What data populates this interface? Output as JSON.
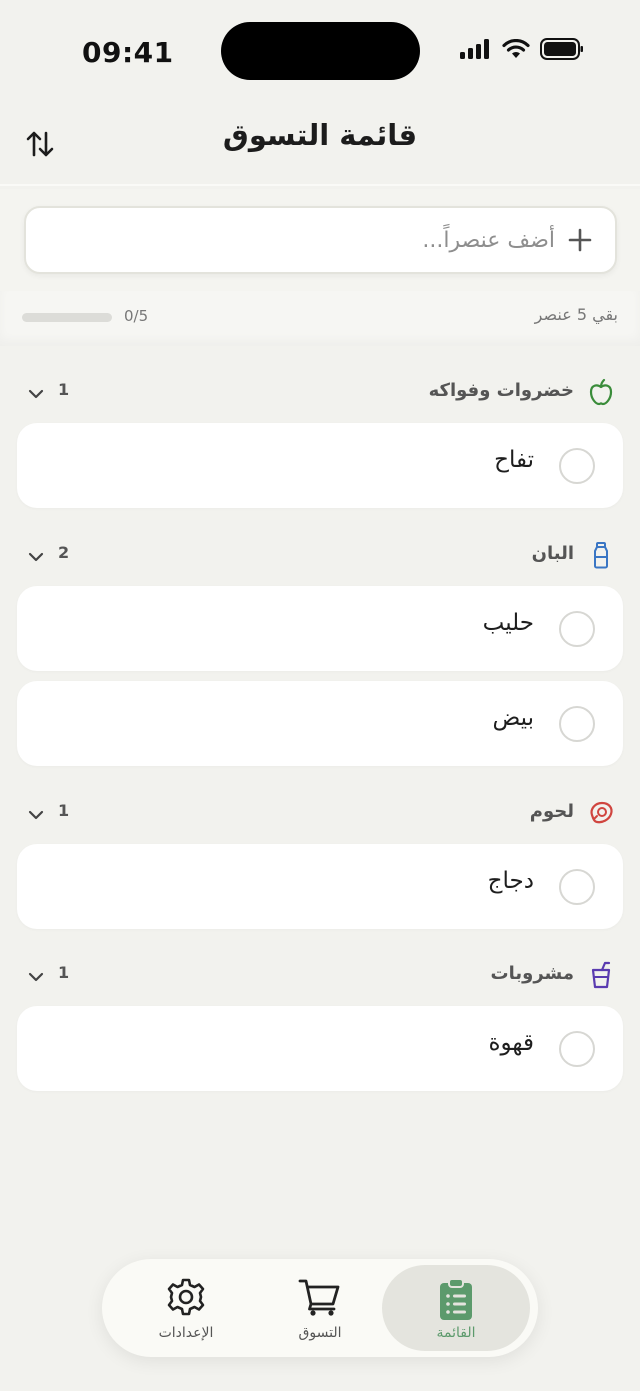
{
  "status_bar": {
    "time": "09:41"
  },
  "header": {
    "title": "قائمة التسوق"
  },
  "add_item": {
    "placeholder": "أضف عنصراً..."
  },
  "progress": {
    "count_text": "0/5",
    "fraction": 0.0,
    "remaining_text": "بقي 5 عنصر"
  },
  "categories": [
    {
      "name": "خضروات وفواكه",
      "count": "1",
      "icon": "apple-icon",
      "color": "#3a8c3a",
      "items": [
        "تفاح"
      ]
    },
    {
      "name": "البان",
      "count": "2",
      "icon": "milk-bottle-icon",
      "color": "#3a76c4",
      "items": [
        "حليب",
        "بيض"
      ]
    },
    {
      "name": "لحوم",
      "count": "1",
      "icon": "meat-icon",
      "color": "#d0453f",
      "items": [
        "دجاج"
      ]
    },
    {
      "name": "مشروبات",
      "count": "1",
      "icon": "drink-cup-icon",
      "color": "#5a3bb0",
      "items": [
        "قهوة"
      ]
    }
  ],
  "tab_bar": {
    "settings": "الإعدادات",
    "shopping": "التسوق",
    "list": "القائمة"
  },
  "colors": {
    "accent": "#5c9a6c",
    "background": "#f2f2ee"
  }
}
